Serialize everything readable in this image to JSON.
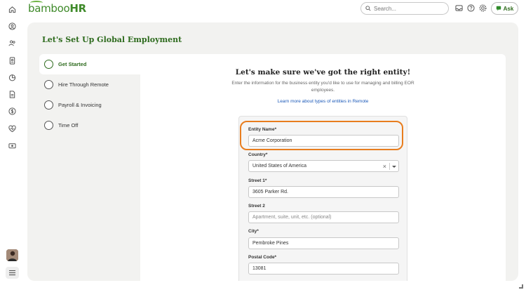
{
  "app": {
    "logo_text": "bamboo",
    "logo_suffix": "HR"
  },
  "topbar": {
    "search_placeholder": "Search...",
    "ask_label": "Ask"
  },
  "panel": {
    "title": "Let's Set Up Global Employment"
  },
  "steps": [
    {
      "label": "Get Started",
      "active": true
    },
    {
      "label": "Hire Through Remote",
      "active": false
    },
    {
      "label": "Payroll & Invoicing",
      "active": false
    },
    {
      "label": "Time Off",
      "active": false
    }
  ],
  "content": {
    "heading": "Let's make sure we've got the right entity!",
    "subtext": "Enter the information for the business entity you'd like to use for managing and billing EOR employees.",
    "learn_link": "Learn more about types of entities in Remote"
  },
  "form": {
    "entity_name": {
      "label": "Entity Name*",
      "value": "Acme Corporation"
    },
    "country": {
      "label": "Country*",
      "value": "United States of America"
    },
    "street1": {
      "label": "Street 1*",
      "value": "3605 Parker Rd."
    },
    "street2": {
      "label": "Street 2",
      "placeholder": "Apartment, suite, unit, etc. (optional)"
    },
    "city": {
      "label": "City*",
      "value": "Pembroke Pines"
    },
    "postal_code": {
      "label": "Postal Code*",
      "value": "13081"
    }
  },
  "colors": {
    "brand_green": "#2e6b1e",
    "highlight_orange": "#e87d1e",
    "link_blue": "#1a58b8"
  }
}
